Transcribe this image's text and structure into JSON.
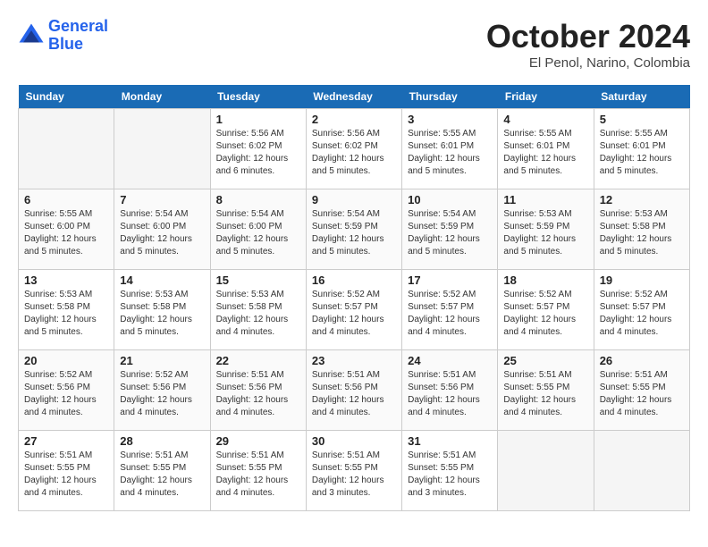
{
  "header": {
    "logo_line1": "General",
    "logo_line2": "Blue",
    "month_title": "October 2024",
    "location": "El Penol, Narino, Colombia"
  },
  "days_of_week": [
    "Sunday",
    "Monday",
    "Tuesday",
    "Wednesday",
    "Thursday",
    "Friday",
    "Saturday"
  ],
  "weeks": [
    [
      {
        "day": "",
        "info": ""
      },
      {
        "day": "",
        "info": ""
      },
      {
        "day": "1",
        "info": "Sunrise: 5:56 AM\nSunset: 6:02 PM\nDaylight: 12 hours\nand 6 minutes."
      },
      {
        "day": "2",
        "info": "Sunrise: 5:56 AM\nSunset: 6:02 PM\nDaylight: 12 hours\nand 5 minutes."
      },
      {
        "day": "3",
        "info": "Sunrise: 5:55 AM\nSunset: 6:01 PM\nDaylight: 12 hours\nand 5 minutes."
      },
      {
        "day": "4",
        "info": "Sunrise: 5:55 AM\nSunset: 6:01 PM\nDaylight: 12 hours\nand 5 minutes."
      },
      {
        "day": "5",
        "info": "Sunrise: 5:55 AM\nSunset: 6:01 PM\nDaylight: 12 hours\nand 5 minutes."
      }
    ],
    [
      {
        "day": "6",
        "info": "Sunrise: 5:55 AM\nSunset: 6:00 PM\nDaylight: 12 hours\nand 5 minutes."
      },
      {
        "day": "7",
        "info": "Sunrise: 5:54 AM\nSunset: 6:00 PM\nDaylight: 12 hours\nand 5 minutes."
      },
      {
        "day": "8",
        "info": "Sunrise: 5:54 AM\nSunset: 6:00 PM\nDaylight: 12 hours\nand 5 minutes."
      },
      {
        "day": "9",
        "info": "Sunrise: 5:54 AM\nSunset: 5:59 PM\nDaylight: 12 hours\nand 5 minutes."
      },
      {
        "day": "10",
        "info": "Sunrise: 5:54 AM\nSunset: 5:59 PM\nDaylight: 12 hours\nand 5 minutes."
      },
      {
        "day": "11",
        "info": "Sunrise: 5:53 AM\nSunset: 5:59 PM\nDaylight: 12 hours\nand 5 minutes."
      },
      {
        "day": "12",
        "info": "Sunrise: 5:53 AM\nSunset: 5:58 PM\nDaylight: 12 hours\nand 5 minutes."
      }
    ],
    [
      {
        "day": "13",
        "info": "Sunrise: 5:53 AM\nSunset: 5:58 PM\nDaylight: 12 hours\nand 5 minutes."
      },
      {
        "day": "14",
        "info": "Sunrise: 5:53 AM\nSunset: 5:58 PM\nDaylight: 12 hours\nand 5 minutes."
      },
      {
        "day": "15",
        "info": "Sunrise: 5:53 AM\nSunset: 5:58 PM\nDaylight: 12 hours\nand 4 minutes."
      },
      {
        "day": "16",
        "info": "Sunrise: 5:52 AM\nSunset: 5:57 PM\nDaylight: 12 hours\nand 4 minutes."
      },
      {
        "day": "17",
        "info": "Sunrise: 5:52 AM\nSunset: 5:57 PM\nDaylight: 12 hours\nand 4 minutes."
      },
      {
        "day": "18",
        "info": "Sunrise: 5:52 AM\nSunset: 5:57 PM\nDaylight: 12 hours\nand 4 minutes."
      },
      {
        "day": "19",
        "info": "Sunrise: 5:52 AM\nSunset: 5:57 PM\nDaylight: 12 hours\nand 4 minutes."
      }
    ],
    [
      {
        "day": "20",
        "info": "Sunrise: 5:52 AM\nSunset: 5:56 PM\nDaylight: 12 hours\nand 4 minutes."
      },
      {
        "day": "21",
        "info": "Sunrise: 5:52 AM\nSunset: 5:56 PM\nDaylight: 12 hours\nand 4 minutes."
      },
      {
        "day": "22",
        "info": "Sunrise: 5:51 AM\nSunset: 5:56 PM\nDaylight: 12 hours\nand 4 minutes."
      },
      {
        "day": "23",
        "info": "Sunrise: 5:51 AM\nSunset: 5:56 PM\nDaylight: 12 hours\nand 4 minutes."
      },
      {
        "day": "24",
        "info": "Sunrise: 5:51 AM\nSunset: 5:56 PM\nDaylight: 12 hours\nand 4 minutes."
      },
      {
        "day": "25",
        "info": "Sunrise: 5:51 AM\nSunset: 5:55 PM\nDaylight: 12 hours\nand 4 minutes."
      },
      {
        "day": "26",
        "info": "Sunrise: 5:51 AM\nSunset: 5:55 PM\nDaylight: 12 hours\nand 4 minutes."
      }
    ],
    [
      {
        "day": "27",
        "info": "Sunrise: 5:51 AM\nSunset: 5:55 PM\nDaylight: 12 hours\nand 4 minutes."
      },
      {
        "day": "28",
        "info": "Sunrise: 5:51 AM\nSunset: 5:55 PM\nDaylight: 12 hours\nand 4 minutes."
      },
      {
        "day": "29",
        "info": "Sunrise: 5:51 AM\nSunset: 5:55 PM\nDaylight: 12 hours\nand 4 minutes."
      },
      {
        "day": "30",
        "info": "Sunrise: 5:51 AM\nSunset: 5:55 PM\nDaylight: 12 hours\nand 3 minutes."
      },
      {
        "day": "31",
        "info": "Sunrise: 5:51 AM\nSunset: 5:55 PM\nDaylight: 12 hours\nand 3 minutes."
      },
      {
        "day": "",
        "info": ""
      },
      {
        "day": "",
        "info": ""
      }
    ]
  ]
}
